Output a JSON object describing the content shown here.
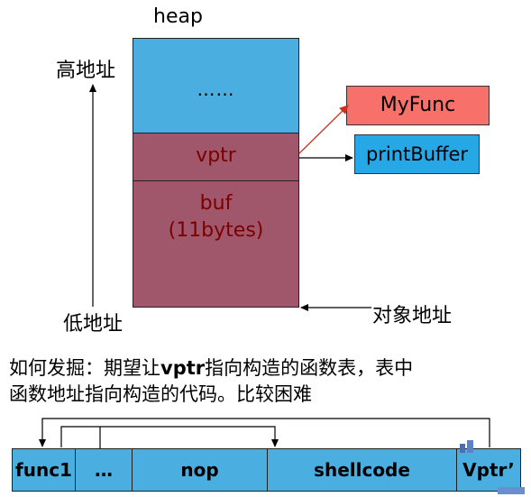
{
  "heap_title": "heap",
  "memory": {
    "top_label": "……",
    "vptr_label": "vptr",
    "buf_line1": "buf",
    "buf_line2": "(11bytes)"
  },
  "axis": {
    "high_address": "高地址",
    "low_address": "低地址"
  },
  "object_address": "对象地址",
  "vtable": {
    "myfunc": "MyFunc",
    "printbuffer": "printBuffer"
  },
  "description": {
    "prefix": "如何发掘：期望让",
    "keyword": "vptr",
    "suffix": "指向构造的函数表，表中",
    "line2": "函数地址指向构造的代码。比较困难"
  },
  "payload": {
    "cells": [
      "func1",
      "…",
      "nop",
      "shellcode",
      "Vptr’"
    ]
  },
  "colors": {
    "heap_blue": "#4aaee0",
    "object_red": "#a0566b",
    "myfunc_red": "#f8706a",
    "printbuffer_blue": "#27a8e6"
  }
}
